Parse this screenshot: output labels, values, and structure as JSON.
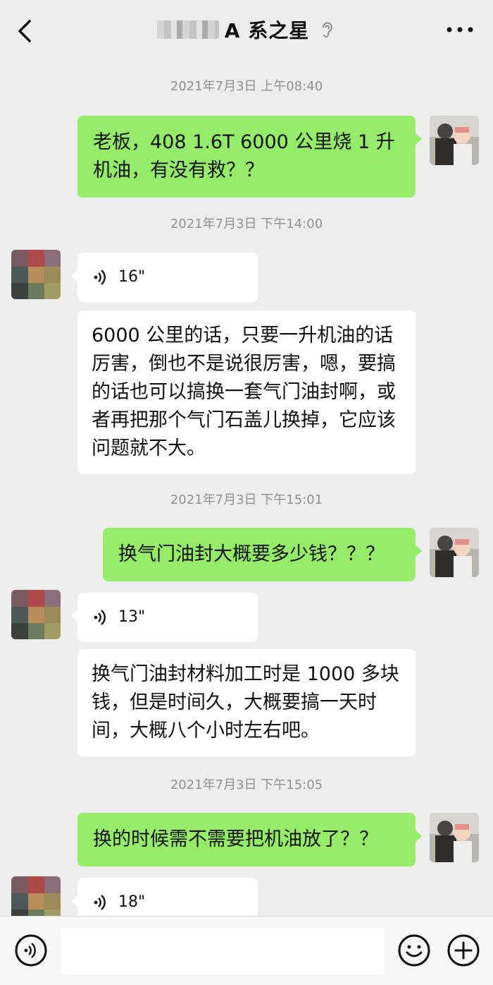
{
  "header": {
    "title": "A 系之星",
    "back_icon": "chevron-left-icon",
    "ear_icon": "ear-icon",
    "more_icon": "more-dots-icon"
  },
  "messages": {
    "ts1": "2021年7月3日 上午08:40",
    "m1": "老板，408  1.6T  6000 公里烧 1 升机油，有没有救？？",
    "ts2": "2021年7月3日 下午14:00",
    "v1": "16\"",
    "m2": "6000 公里的话，只要一升机油的话厉害，倒也不是说很厉害，嗯，要搞的话也可以搞换一套气门油封啊，或者再把那个气门石盖儿换掉，它应该问题就不大。",
    "ts3": "2021年7月3日 下午15:01",
    "m3": "换气门油封大概要多少钱？？？",
    "v2": "13\"",
    "m4": "换气门油封材料加工时是 1000 多块钱，但是时间久，大概要搞一天时间，大概八个小时左右吧。",
    "ts4": "2021年7月3日 下午15:05",
    "m5": "换的时候需不需要把机油放了？？",
    "v3": "18\""
  },
  "colors": {
    "sent_bubble": "#95ec69",
    "recv_bubble": "#ffffff",
    "background": "#ededed"
  }
}
